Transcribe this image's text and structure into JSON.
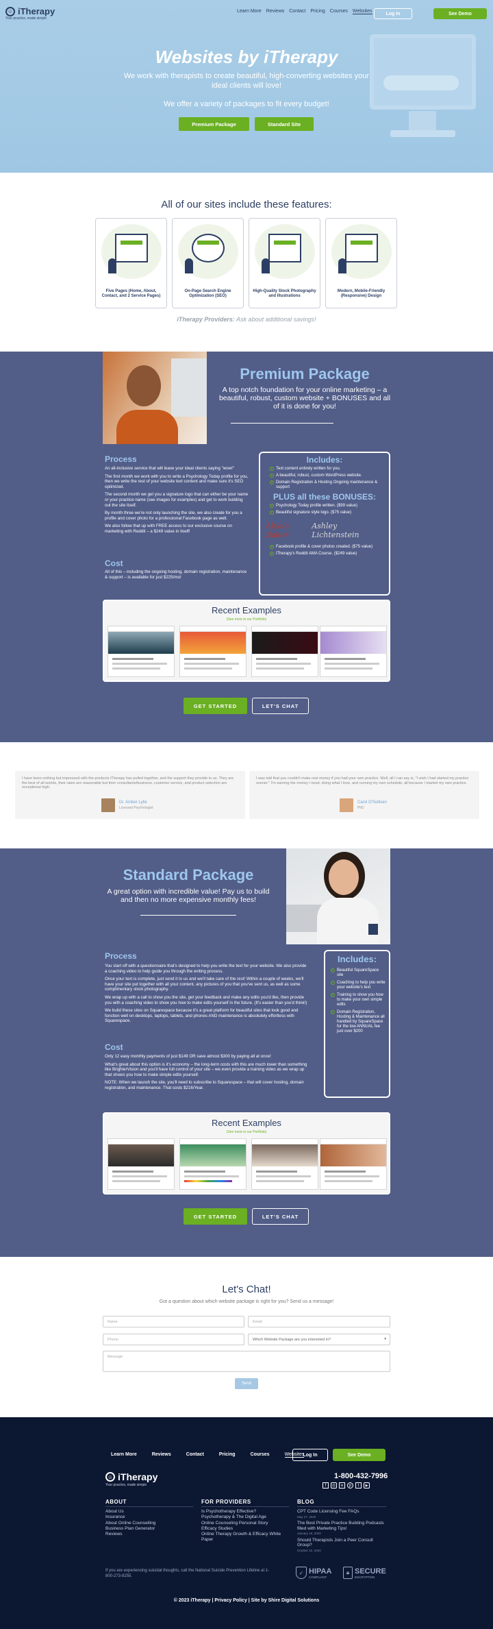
{
  "header": {
    "logo_name": "iTherapy",
    "logo_tag": "Your practice, made simple",
    "nav": [
      "Learn More",
      "Reviews",
      "Contact",
      "Pricing",
      "Courses",
      "Websites"
    ],
    "login": "Log In",
    "demo": "See Demo"
  },
  "hero": {
    "title": "Websites by iTherapy",
    "subtitle": "We work with therapists to create beautiful, high-converting websites your ideal clients will love!",
    "subtitle2": "We offer a variety of packages to fit every budget!",
    "btn_premium": "Premium Package",
    "btn_standard": "Standard Site"
  },
  "features": {
    "title": "All of our sites include these features:",
    "cards": [
      "Five Pages (Home, About, Contact, and 2 Service Pages)",
      "On-Page Search Engine Optimization (SEO)",
      "High-Quality Stock Photography and Illustrations",
      "Modern, Mobile-Friendly (Responsive) Design"
    ],
    "providers_bold": "iTherapy Providers:",
    "providers_rest": " Ask about additional savings!"
  },
  "premium": {
    "title": "Premium Package",
    "tagline": "A top notch foundation for your online marketing – a beautiful, robust, custom website + BONUSES and all of it is done for you!",
    "process_h": "Process",
    "process": [
      "An all-inclusive service that will leave your ideal clients saying \"wow!\"",
      "The first month we work with you to write a Psychology Today profile for you, then we write the rest of your website text content and make sure it's SEO optimized.",
      "The second month we get you a signature logo that can either be your name or your practice name (see images for examples) and get to work building out the site itself.",
      "By month three we're not only launching the site, we also create for you a profile and cover photo for a professional Facebook page as well.",
      "We also follow that up with FREE access to our exclusive course on marketing with Reddit – a $249 value in itself!"
    ],
    "cost_h": "Cost",
    "cost": "All of this – including the ongoing hosting, domain registration, maintenance & support – is available for just $225/mo!",
    "includes_h": "Includes:",
    "includes": [
      "Text content entirely written for you.",
      "A beautiful, robust, custom WordPress website.",
      "Domain Registration & Hosting Ongoing maintenance & support"
    ],
    "bonuses_h": "PLUS all these BONUSES:",
    "bonuses": [
      "Psychology Today profile written. ($99 value)",
      "Beautiful signature style logo. ($75 value)"
    ],
    "bonuses2": [
      "Facebook profile & cover photos created. ($75 value)",
      "iTherapy's Reddit AMA Course. ($249 value)"
    ],
    "sig1": "Alycia Baker",
    "sig2": "Ashley Lichtenstein",
    "recent_h": "Recent Examples",
    "recent_s": "(See more in our Portfolio)",
    "start": "GET STARTED",
    "chat": "LET'S CHAT"
  },
  "testimonials": [
    {
      "quote": "I have been nothing but impressed with the products iTherapy has pulled together, and the support they provide to us. They are the best of all worlds, their rates are reasonable but their consultants/business, customer service, and product selection are exceptional high.",
      "name": "Dr. Amber Lytle",
      "role": "Licensed Psychologist"
    },
    {
      "quote": "I was told that you couldn't make real money if you had your own practice. Well, all I can say is, \"I wish I had started my practice sooner.\" I'm earning the money I need, doing what I love, and running my own schedule, all because I started my own practice.",
      "name": "Carol O'Sullivan",
      "role": "PhD"
    }
  ],
  "standard": {
    "title": "Standard Package",
    "tagline": "A great option with incredible value! Pay us to build and then no more expensive monthly fees!",
    "process_h": "Process",
    "process": [
      "You start off with a questionnaire that's designed to help you write the text for your website. We also provide a coaching video to help guide you through the writing process.",
      "Once your text is complete, just send it to us and we'll take care of the rest! Within a couple of weeks, we'll have your site put together with all your content, any pictures of you that you've sent us, as well as some complimentary stock photography.",
      "We wrap up with a call to show you the site, get your feedback and make any edits you'd like, then provide you with a coaching video to show you how to make edits yourself in the future. (It's easier than you'd think!)",
      "We build these sites on Squarespace because it's a great platform for beautiful sites that look good and function well on desktops, laptops, tablets, and phones AND maintenance is absolutely effortless with Squarespace."
    ],
    "cost_h": "Cost",
    "cost": [
      "Only 12 easy monthly payments of just $149 OR save almost $300 by paying all at once!",
      "What's great about this option is it's economy – the long-term costs with this are much lower than something like BrighterVision and you'll have full control of your site – we even provide a training video as we wrap up that shows you how to make simple edits yourself.",
      "NOTE: When we launch the site, you'll need to subscribe to Squarespace – that will cover hosting, domain registration, and maintenance. That costs $216/Year."
    ],
    "includes_h": "Includes:",
    "includes": [
      "Beautiful SquareSpace site",
      "Coaching to help you write your website's text",
      "Training to show you how to make your own simple edits",
      "Domain Registration, Hosting & Maintenance all handled by SquareSpace for the low ANNUAL fee just over $200"
    ],
    "recent_h": "Recent Examples",
    "recent_s": "(See more in our Portfolio)",
    "start": "GET STARTED",
    "chat": "LET'S CHAT"
  },
  "contact": {
    "title": "Let's Chat!",
    "sub": "Got a question about which website package is right for you? Send us a message!",
    "name": "Name",
    "email": "Email",
    "phone": "Phone",
    "package": "Which Website Package are you interested in?",
    "message": "Message",
    "send": "Send"
  },
  "footer": {
    "nav": [
      "Learn More",
      "Reviews",
      "Contact",
      "Pricing",
      "Courses",
      "Websites"
    ],
    "login": "Log In",
    "demo": "See Demo",
    "logo": "iTherapy",
    "logo_tag": "Your practice, made simple",
    "phone": "1-800-432-7996",
    "about_h": "ABOUT",
    "about": [
      "About Us",
      "Insurance",
      "About Online Counselling",
      "Business Plan Generator",
      "Reviews"
    ],
    "prov_h": "FOR PROVIDERS",
    "prov": [
      "Is Psychotherapy Effective?",
      "Psychotherapy & The Digital Age",
      "Online Counseling Personal Story",
      "Efficacy Studies",
      "Online Therapy Growth & Efficacy White Paper"
    ],
    "blog_h": "BLOG",
    "blog": [
      {
        "t": "CPT Code Licensing Fee FAQs",
        "d": "May 27, 2020"
      },
      {
        "t": "The Best Private Practice Building Podcasts filled with Marketing Tips!",
        "d": "January 19, 2020"
      },
      {
        "t": "Should Therapists Join a Peer Consult Group?",
        "d": "October 22, 2020"
      }
    ],
    "crisis": "If you are experiencing suicidal thoughts, call the National Suicide Prevention Lifeline at 1-800-273-8255.",
    "hipaa": "HIPAA",
    "hipaa_s": "COMPLIANT",
    "secure": "SECURE",
    "secure_s": "ENCRYPTION",
    "copy": "© 2023 iTherapy | Privacy Policy | Site by Shire Digital Solutions"
  },
  "colors": {
    "green": "#6ab022",
    "navy": "#2c3e63",
    "purple": "#525d88",
    "sky": "#a9cde6",
    "footer": "#0c1732"
  }
}
